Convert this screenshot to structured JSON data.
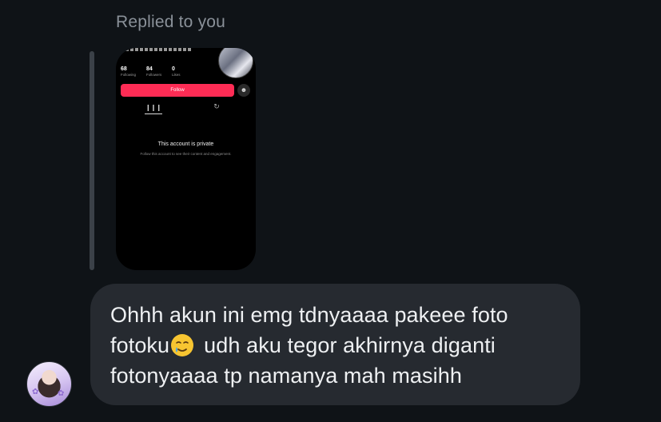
{
  "reply": {
    "label": "Replied to you"
  },
  "story": {
    "stats": [
      {
        "value": "68",
        "label": "Following"
      },
      {
        "value": "84",
        "label": "Followers"
      },
      {
        "value": "0",
        "label": "Likes"
      }
    ],
    "follow_label": "Follow",
    "private_title": "This account is private",
    "private_subtitle": "Follow this account to see their content and engagement."
  },
  "message": {
    "lines": [
      "Ohhh akun ini emg tdnyaaaa pakeee foto",
      "fotoku",
      "udh aku tegor akhirnya diganti",
      "fotonyaaaa tp namanya mah masihh"
    ],
    "emoji": "smiling-face-with-tear-icon"
  },
  "colors": {
    "background": "#0f1317",
    "bubble": "#262a30",
    "follow_button": "#fe2c55",
    "reply_label": "#8a9199"
  }
}
